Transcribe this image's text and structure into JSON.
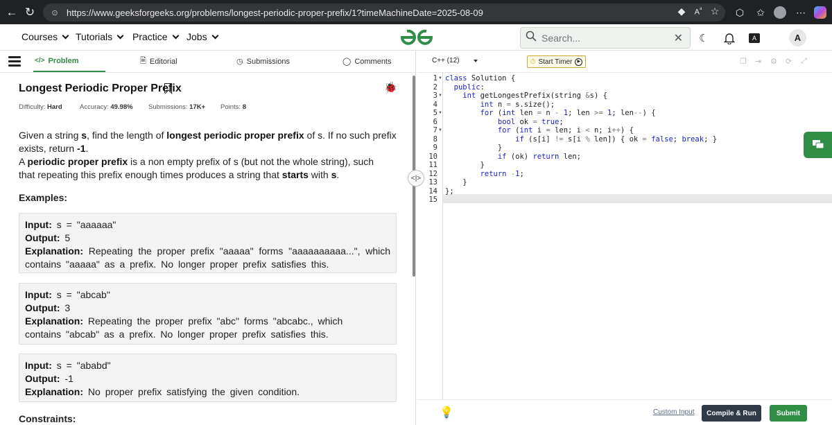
{
  "browser": {
    "url": "https://www.geeksforgeeks.org/problems/longest-periodic-proper-prefix/1?timeMachineDate=2025-08-09"
  },
  "header": {
    "menu": [
      {
        "label": "Courses"
      },
      {
        "label": "Tutorials"
      },
      {
        "label": "Practice"
      },
      {
        "label": "Jobs"
      }
    ],
    "search_placeholder": "Search...",
    "avatar": "A"
  },
  "tabs": {
    "problem": "Problem",
    "editorial": "Editorial",
    "submissions": "Submissions",
    "comments": "Comments"
  },
  "problem": {
    "title": "Longest Periodic Proper Prefix",
    "difficulty_label": "Difficulty:",
    "difficulty": "Hard",
    "accuracy_label": "Accuracy:",
    "accuracy": "49.98%",
    "submissions_label": "Submissions:",
    "submissions": "17K+",
    "points_label": "Points:",
    "points": "8",
    "desc1": [
      "Given a string ",
      "s",
      ", find the length of ",
      "longest periodic proper prefix",
      " of s. If no such prefix exists, return ",
      "-1",
      "."
    ],
    "desc2": [
      "A ",
      "periodic proper prefix",
      " is a non empty prefix of s (but not the whole string), such that repeating this prefix enough times produces a string that ",
      "starts",
      " with ",
      "s",
      "."
    ],
    "examples_heading": "Examples:",
    "input_label": "Input:",
    "output_label": "Output:",
    "explanation_label": "Explanation:",
    "examples": [
      {
        "input": "s = \"aaaaaa\"",
        "output": "5",
        "explanation": "Repeating the proper prefix \"aaaaa\" forms \"aaaaaaaaaa...\", which contains \"aaaaa\" as a prefix. No longer proper prefix satisfies this."
      },
      {
        "input": "s = \"abcab\"",
        "output": "3",
        "explanation": "Repeating the proper prefix \"abc\" forms \"abcabc., which contains \"abcab\" as a prefix. No longer proper prefix satisfies this."
      },
      {
        "input": "s = \"ababd\"",
        "output": "-1",
        "explanation": "No proper prefix satisfying the given condition."
      }
    ],
    "constraints_heading": "Constraints:"
  },
  "editor": {
    "language": "C++ (12)",
    "timer_label": "Start Timer",
    "line_numbers": [
      "1",
      "2",
      "3",
      "4",
      "5",
      "6",
      "7",
      "8",
      "9",
      "10",
      "11",
      "12",
      "13",
      "14",
      "15"
    ],
    "custom_input": "Custom Input",
    "compile_label": "Compile & Run",
    "submit_label": "Submit"
  },
  "colors": {
    "brand_green": "#2f8d46",
    "compile_bg": "#2f3a46",
    "keyword_blue": "#1b22c7"
  }
}
